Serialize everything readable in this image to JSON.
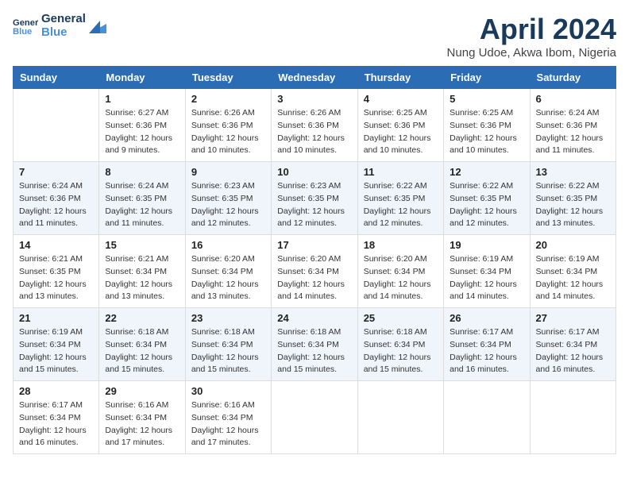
{
  "header": {
    "logo_line1": "General",
    "logo_line2": "Blue",
    "month_title": "April 2024",
    "subtitle": "Nung Udoe, Akwa Ibom, Nigeria"
  },
  "days_of_week": [
    "Sunday",
    "Monday",
    "Tuesday",
    "Wednesday",
    "Thursday",
    "Friday",
    "Saturday"
  ],
  "weeks": [
    [
      {
        "day": "",
        "info": ""
      },
      {
        "day": "1",
        "info": "Sunrise: 6:27 AM\nSunset: 6:36 PM\nDaylight: 12 hours\nand 9 minutes."
      },
      {
        "day": "2",
        "info": "Sunrise: 6:26 AM\nSunset: 6:36 PM\nDaylight: 12 hours\nand 10 minutes."
      },
      {
        "day": "3",
        "info": "Sunrise: 6:26 AM\nSunset: 6:36 PM\nDaylight: 12 hours\nand 10 minutes."
      },
      {
        "day": "4",
        "info": "Sunrise: 6:25 AM\nSunset: 6:36 PM\nDaylight: 12 hours\nand 10 minutes."
      },
      {
        "day": "5",
        "info": "Sunrise: 6:25 AM\nSunset: 6:36 PM\nDaylight: 12 hours\nand 10 minutes."
      },
      {
        "day": "6",
        "info": "Sunrise: 6:24 AM\nSunset: 6:36 PM\nDaylight: 12 hours\nand 11 minutes."
      }
    ],
    [
      {
        "day": "7",
        "info": "Sunrise: 6:24 AM\nSunset: 6:36 PM\nDaylight: 12 hours\nand 11 minutes."
      },
      {
        "day": "8",
        "info": "Sunrise: 6:24 AM\nSunset: 6:35 PM\nDaylight: 12 hours\nand 11 minutes."
      },
      {
        "day": "9",
        "info": "Sunrise: 6:23 AM\nSunset: 6:35 PM\nDaylight: 12 hours\nand 12 minutes."
      },
      {
        "day": "10",
        "info": "Sunrise: 6:23 AM\nSunset: 6:35 PM\nDaylight: 12 hours\nand 12 minutes."
      },
      {
        "day": "11",
        "info": "Sunrise: 6:22 AM\nSunset: 6:35 PM\nDaylight: 12 hours\nand 12 minutes."
      },
      {
        "day": "12",
        "info": "Sunrise: 6:22 AM\nSunset: 6:35 PM\nDaylight: 12 hours\nand 12 minutes."
      },
      {
        "day": "13",
        "info": "Sunrise: 6:22 AM\nSunset: 6:35 PM\nDaylight: 12 hours\nand 13 minutes."
      }
    ],
    [
      {
        "day": "14",
        "info": "Sunrise: 6:21 AM\nSunset: 6:35 PM\nDaylight: 12 hours\nand 13 minutes."
      },
      {
        "day": "15",
        "info": "Sunrise: 6:21 AM\nSunset: 6:34 PM\nDaylight: 12 hours\nand 13 minutes."
      },
      {
        "day": "16",
        "info": "Sunrise: 6:20 AM\nSunset: 6:34 PM\nDaylight: 12 hours\nand 13 minutes."
      },
      {
        "day": "17",
        "info": "Sunrise: 6:20 AM\nSunset: 6:34 PM\nDaylight: 12 hours\nand 14 minutes."
      },
      {
        "day": "18",
        "info": "Sunrise: 6:20 AM\nSunset: 6:34 PM\nDaylight: 12 hours\nand 14 minutes."
      },
      {
        "day": "19",
        "info": "Sunrise: 6:19 AM\nSunset: 6:34 PM\nDaylight: 12 hours\nand 14 minutes."
      },
      {
        "day": "20",
        "info": "Sunrise: 6:19 AM\nSunset: 6:34 PM\nDaylight: 12 hours\nand 14 minutes."
      }
    ],
    [
      {
        "day": "21",
        "info": "Sunrise: 6:19 AM\nSunset: 6:34 PM\nDaylight: 12 hours\nand 15 minutes."
      },
      {
        "day": "22",
        "info": "Sunrise: 6:18 AM\nSunset: 6:34 PM\nDaylight: 12 hours\nand 15 minutes."
      },
      {
        "day": "23",
        "info": "Sunrise: 6:18 AM\nSunset: 6:34 PM\nDaylight: 12 hours\nand 15 minutes."
      },
      {
        "day": "24",
        "info": "Sunrise: 6:18 AM\nSunset: 6:34 PM\nDaylight: 12 hours\nand 15 minutes."
      },
      {
        "day": "25",
        "info": "Sunrise: 6:18 AM\nSunset: 6:34 PM\nDaylight: 12 hours\nand 15 minutes."
      },
      {
        "day": "26",
        "info": "Sunrise: 6:17 AM\nSunset: 6:34 PM\nDaylight: 12 hours\nand 16 minutes."
      },
      {
        "day": "27",
        "info": "Sunrise: 6:17 AM\nSunset: 6:34 PM\nDaylight: 12 hours\nand 16 minutes."
      }
    ],
    [
      {
        "day": "28",
        "info": "Sunrise: 6:17 AM\nSunset: 6:34 PM\nDaylight: 12 hours\nand 16 minutes."
      },
      {
        "day": "29",
        "info": "Sunrise: 6:16 AM\nSunset: 6:34 PM\nDaylight: 12 hours\nand 17 minutes."
      },
      {
        "day": "30",
        "info": "Sunrise: 6:16 AM\nSunset: 6:34 PM\nDaylight: 12 hours\nand 17 minutes."
      },
      {
        "day": "",
        "info": ""
      },
      {
        "day": "",
        "info": ""
      },
      {
        "day": "",
        "info": ""
      },
      {
        "day": "",
        "info": ""
      }
    ]
  ]
}
